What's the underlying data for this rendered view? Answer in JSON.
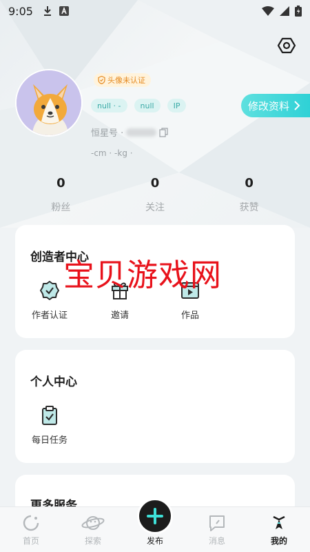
{
  "status_bar": {
    "time": "9:05"
  },
  "profile": {
    "verify_badge": "头像未认证",
    "tags": [
      "null · -",
      "null",
      "IP"
    ],
    "edit_button": "修改资料",
    "hx_label": "恒星号 ·",
    "body_info": "-cm · -kg ·"
  },
  "stats": [
    {
      "value": "0",
      "label": "粉丝"
    },
    {
      "value": "0",
      "label": "关注"
    },
    {
      "value": "0",
      "label": "获赞"
    }
  ],
  "creator_center": {
    "title": "创造者中心",
    "items": [
      {
        "label": "作者认证",
        "icon": "badge-check-icon"
      },
      {
        "label": "邀请",
        "icon": "gift-icon"
      },
      {
        "label": "作品",
        "icon": "video-icon"
      }
    ]
  },
  "personal_center": {
    "title": "个人中心",
    "items": [
      {
        "label": "每日任务",
        "icon": "clipboard-check-icon"
      }
    ]
  },
  "more_services": {
    "title": "更多服务"
  },
  "watermark": "宝贝游戏网",
  "bottom_nav": [
    {
      "label": "首页",
      "icon": "home-icon"
    },
    {
      "label": "探索",
      "icon": "planet-icon"
    },
    {
      "label": "发布",
      "icon": "plus-icon"
    },
    {
      "label": "消息",
      "icon": "message-icon"
    },
    {
      "label": "我的",
      "icon": "profile-icon"
    }
  ],
  "colors": {
    "accent": "#2fd1d6",
    "tag_bg": "#dbf3f2",
    "watermark": "#e8121b"
  }
}
